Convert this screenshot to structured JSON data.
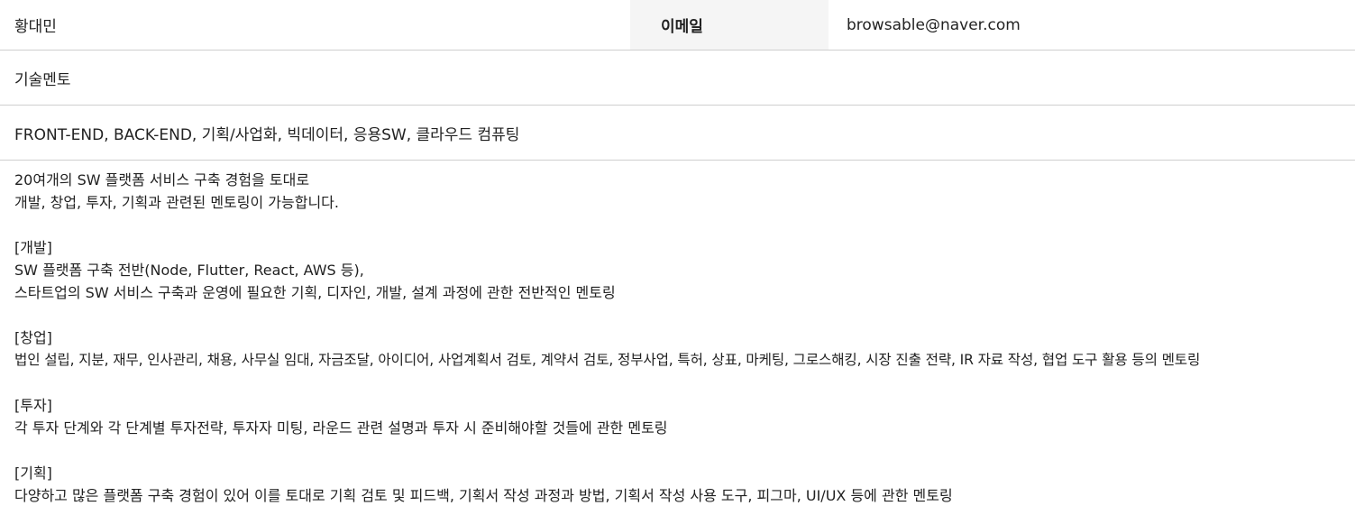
{
  "profile": {
    "name": "황대민",
    "email_label": "이메일",
    "email_value": "browsable@naver.com",
    "role": "기술멘토",
    "fields": "FRONT-END, BACK-END, 기획/사업화, 빅데이터, 응용SW, 클라우드 컴퓨팅"
  },
  "description": {
    "intro_1": "20여개의 SW 플랫폼 서비스 구축 경험을 토대로",
    "intro_2": "개발, 창업, 투자, 기획과 관련된 멘토링이 가능합니다.",
    "dev_heading": "[개발]",
    "dev_1": "SW 플랫폼 구축 전반(Node, Flutter, React, AWS 등),",
    "dev_2": "스타트업의 SW 서비스 구축과 운영에 필요한 기획, 디자인, 개발, 설계 과정에 관한 전반적인 멘토링",
    "startup_heading": "[창업]",
    "startup_1": "법인 설립, 지분, 재무, 인사관리, 채용, 사무실 임대, 자금조달, 아이디어, 사업계획서 검토, 계약서 검토, 정부사업, 특허, 상표, 마케팅, 그로스해킹, 시장 진출 전략, IR 자료 작성, 협업 도구 활용 등의 멘토링",
    "invest_heading": "[투자]",
    "invest_1": "각 투자 단계와 각 단계별 투자전략, 투자자 미팅, 라운드 관련 설명과 투자 시 준비해야할 것들에 관한 멘토링",
    "plan_heading": "[기획]",
    "plan_1": "다양하고 많은 플랫폼 구축 경험이 있어 이를 토대로 기획 검토 및 피드백, 기획서 작성 과정과 방법, 기획서 작성 사용 도구, 피그마, UI/UX 등에 관한 멘토링"
  }
}
